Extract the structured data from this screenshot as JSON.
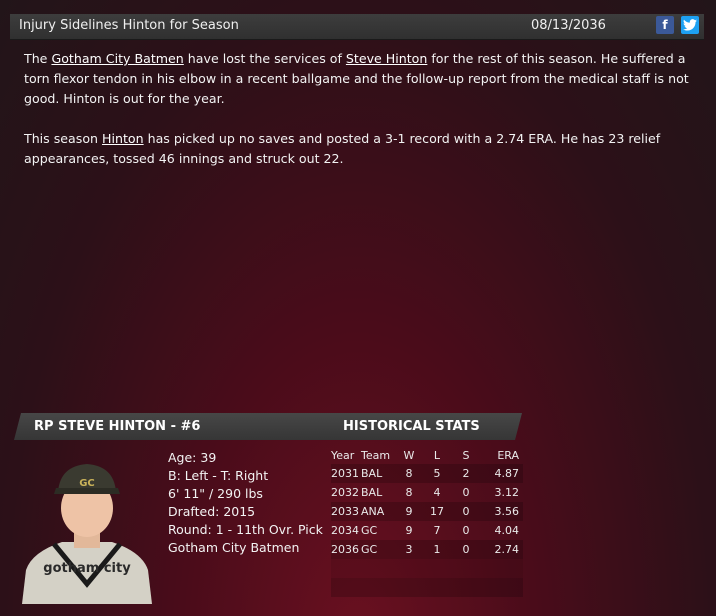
{
  "header": {
    "title": "Injury Sidelines Hinton for Season",
    "date": "08/13/2036",
    "facebook_icon": "f",
    "twitter_icon": "twitter-bird"
  },
  "article": {
    "p1": {
      "pre": "The ",
      "team_link": "Gotham City Batmen",
      "mid": " have lost the services of ",
      "player_link": "Steve Hinton",
      "post": " for the rest of this season. He suffered a torn flexor tendon in his elbow in a recent ballgame and the follow-up report from the medical staff is not good. Hinton is out for the year."
    },
    "p2": {
      "pre": "This season ",
      "player_link": "Hinton",
      "post": " has picked up no saves and posted a 3-1 record with a 2.74 ERA. He has 23 relief appearances, tossed 46 innings and struck out 22."
    }
  },
  "player": {
    "name_line": "RP STEVE HINTON - #6",
    "age": "Age: 39",
    "bats_throws": "B: Left - T: Right",
    "height_weight": "6' 11\" / 290 lbs",
    "drafted": "Drafted: 2015",
    "round": "Round: 1 - 11th Ovr. Pick",
    "team": "Gotham City Batmen",
    "jersey_text": "gotham city"
  },
  "stats": {
    "title": "HISTORICAL STATS",
    "headers": {
      "year": "Year",
      "team": "Team",
      "w": "W",
      "l": "L",
      "s": "S",
      "era": "ERA"
    },
    "rows": [
      {
        "year": "2031",
        "team": "BAL",
        "w": "8",
        "l": "5",
        "s": "2",
        "era": "4.87"
      },
      {
        "year": "2032",
        "team": "BAL",
        "w": "8",
        "l": "4",
        "s": "0",
        "era": "3.12"
      },
      {
        "year": "2033",
        "team": "ANA",
        "w": "9",
        "l": "17",
        "s": "0",
        "era": "3.56"
      },
      {
        "year": "2034",
        "team": "GC",
        "w": "9",
        "l": "7",
        "s": "0",
        "era": "4.04"
      },
      {
        "year": "2036",
        "team": "GC",
        "w": "3",
        "l": "1",
        "s": "0",
        "era": "2.74"
      }
    ]
  },
  "colors": {
    "accent_fb": "#3b5998",
    "accent_tw": "#1da1f2",
    "background": "#4a0c1a"
  }
}
